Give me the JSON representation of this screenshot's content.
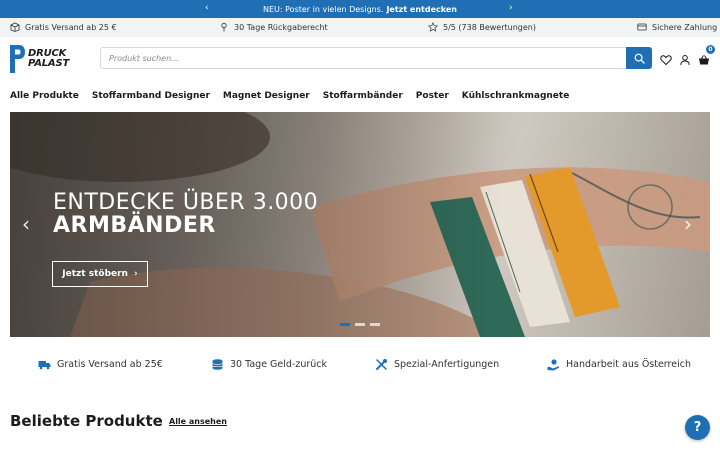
{
  "announcement": {
    "text": "NEU: Poster in vielen Designs.",
    "link": "Jetzt entdecken"
  },
  "usps": [
    {
      "icon": "box-icon",
      "text": "Gratis Versand ab 25 €"
    },
    {
      "icon": "pin-icon",
      "text": "30 Tage Rückgaberecht"
    },
    {
      "icon": "star-icon",
      "text": "5/5 (738 Bewertungen)"
    },
    {
      "icon": "card-icon",
      "text": "Sichere Zahlung"
    }
  ],
  "logo": {
    "line1": "DRUCK",
    "line2": "PALAST"
  },
  "search": {
    "placeholder": "Produkt suchen..."
  },
  "cart": {
    "count": "0"
  },
  "nav": [
    "Alle Produkte",
    "Stoffarmband Designer",
    "Magnet Designer",
    "Stoffarmbänder",
    "Poster",
    "Kühlschrankmagnete"
  ],
  "hero": {
    "line1": "ENTDECKE ÜBER 3.000",
    "line2": "ARMBÄNDER",
    "cta": "Jetzt stöbern",
    "slides": 3,
    "active_slide": 1
  },
  "features": [
    {
      "icon": "truck-icon",
      "text": "Gratis Versand ab 25€"
    },
    {
      "icon": "coins-icon",
      "text": "30 Tage Geld-zurück"
    },
    {
      "icon": "tools-icon",
      "text": "Spezial-Anfertigungen"
    },
    {
      "icon": "hand-icon",
      "text": "Handarbeit aus Österreich"
    }
  ],
  "section": {
    "title": "Beliebte Produkte",
    "link": "Alle ansehen"
  },
  "help": {
    "label": "?"
  },
  "colors": {
    "brand": "#1f6fb5",
    "text": "#1c1c1c",
    "usp_bg": "#f1f3f5"
  }
}
